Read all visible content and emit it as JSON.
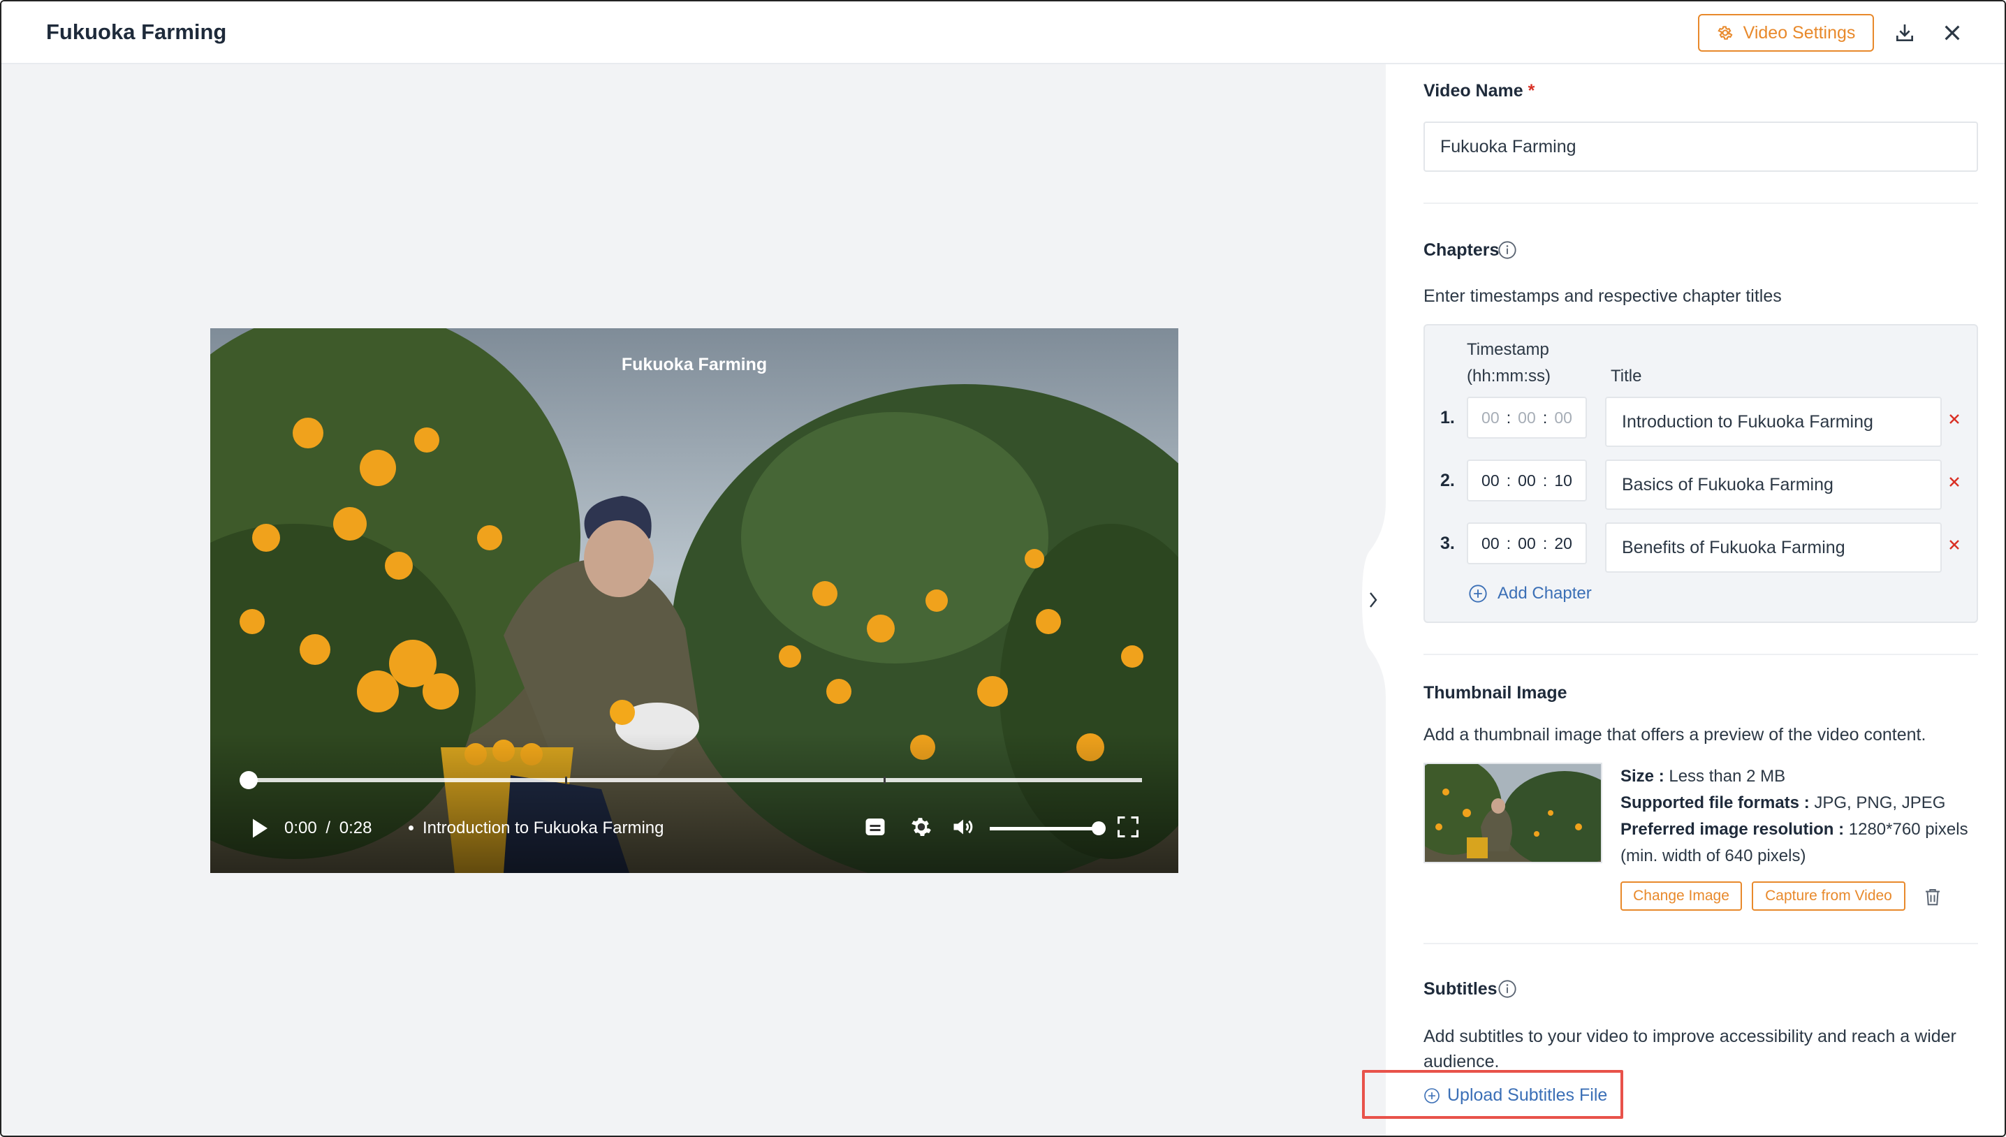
{
  "header": {
    "title": "Fukuoka Farming",
    "settings_label": "Video Settings",
    "accent_color": "#e8892b"
  },
  "player": {
    "overlay_title": "Fukuoka Farming",
    "current_time": "0:00",
    "time_separator": "/",
    "duration": "0:28",
    "current_chapter": "Introduction to Fukuoka Farming",
    "progress_fraction": 0,
    "volume_fraction": 1.0
  },
  "panel": {
    "video_name_label": "Video Name",
    "required_mark": "*",
    "video_name_value": "Fukuoka Farming",
    "chapters_label": "Chapters",
    "chapters_desc": "Enter timestamps and respective chapter titles",
    "timestamp_head_1": "Timestamp",
    "timestamp_head_2": "(hh:mm:ss)",
    "title_head": "Title",
    "chapters": [
      {
        "num": "1.",
        "hh": "00",
        "mm": "00",
        "ss": "00",
        "title": "Introduction to Fukuoka Farming",
        "placeholder": true
      },
      {
        "num": "2.",
        "hh": "00",
        "mm": "00",
        "ss": "10",
        "title": "Basics of Fukuoka Farming",
        "placeholder": false
      },
      {
        "num": "3.",
        "hh": "00",
        "mm": "00",
        "ss": "20",
        "title": "Benefits of Fukuoka Farming",
        "placeholder": false
      }
    ],
    "add_chapter": "Add Chapter",
    "thumbnail_label": "Thumbnail Image",
    "thumbnail_desc": "Add a thumbnail image that offers a preview of the video content.",
    "size_key": "Size :",
    "size_val": "Less than 2 MB",
    "formats_key": "Supported file formats :",
    "formats_val": "JPG, PNG, JPEG",
    "resolution_key": "Preferred image resolution :",
    "resolution_val": "1280*760 pixels",
    "resolution_note": "(min. width of 640 pixels)",
    "change_image": "Change Image",
    "capture_from_video": "Capture from Video",
    "subtitles_label": "Subtitles",
    "subtitles_desc": "Add subtitles to your video to improve accessibility and reach a wider audience.",
    "upload_subtitles": "Upload Subtitles File",
    "link_color": "#3b6fb6",
    "remove_color": "#d93025"
  }
}
